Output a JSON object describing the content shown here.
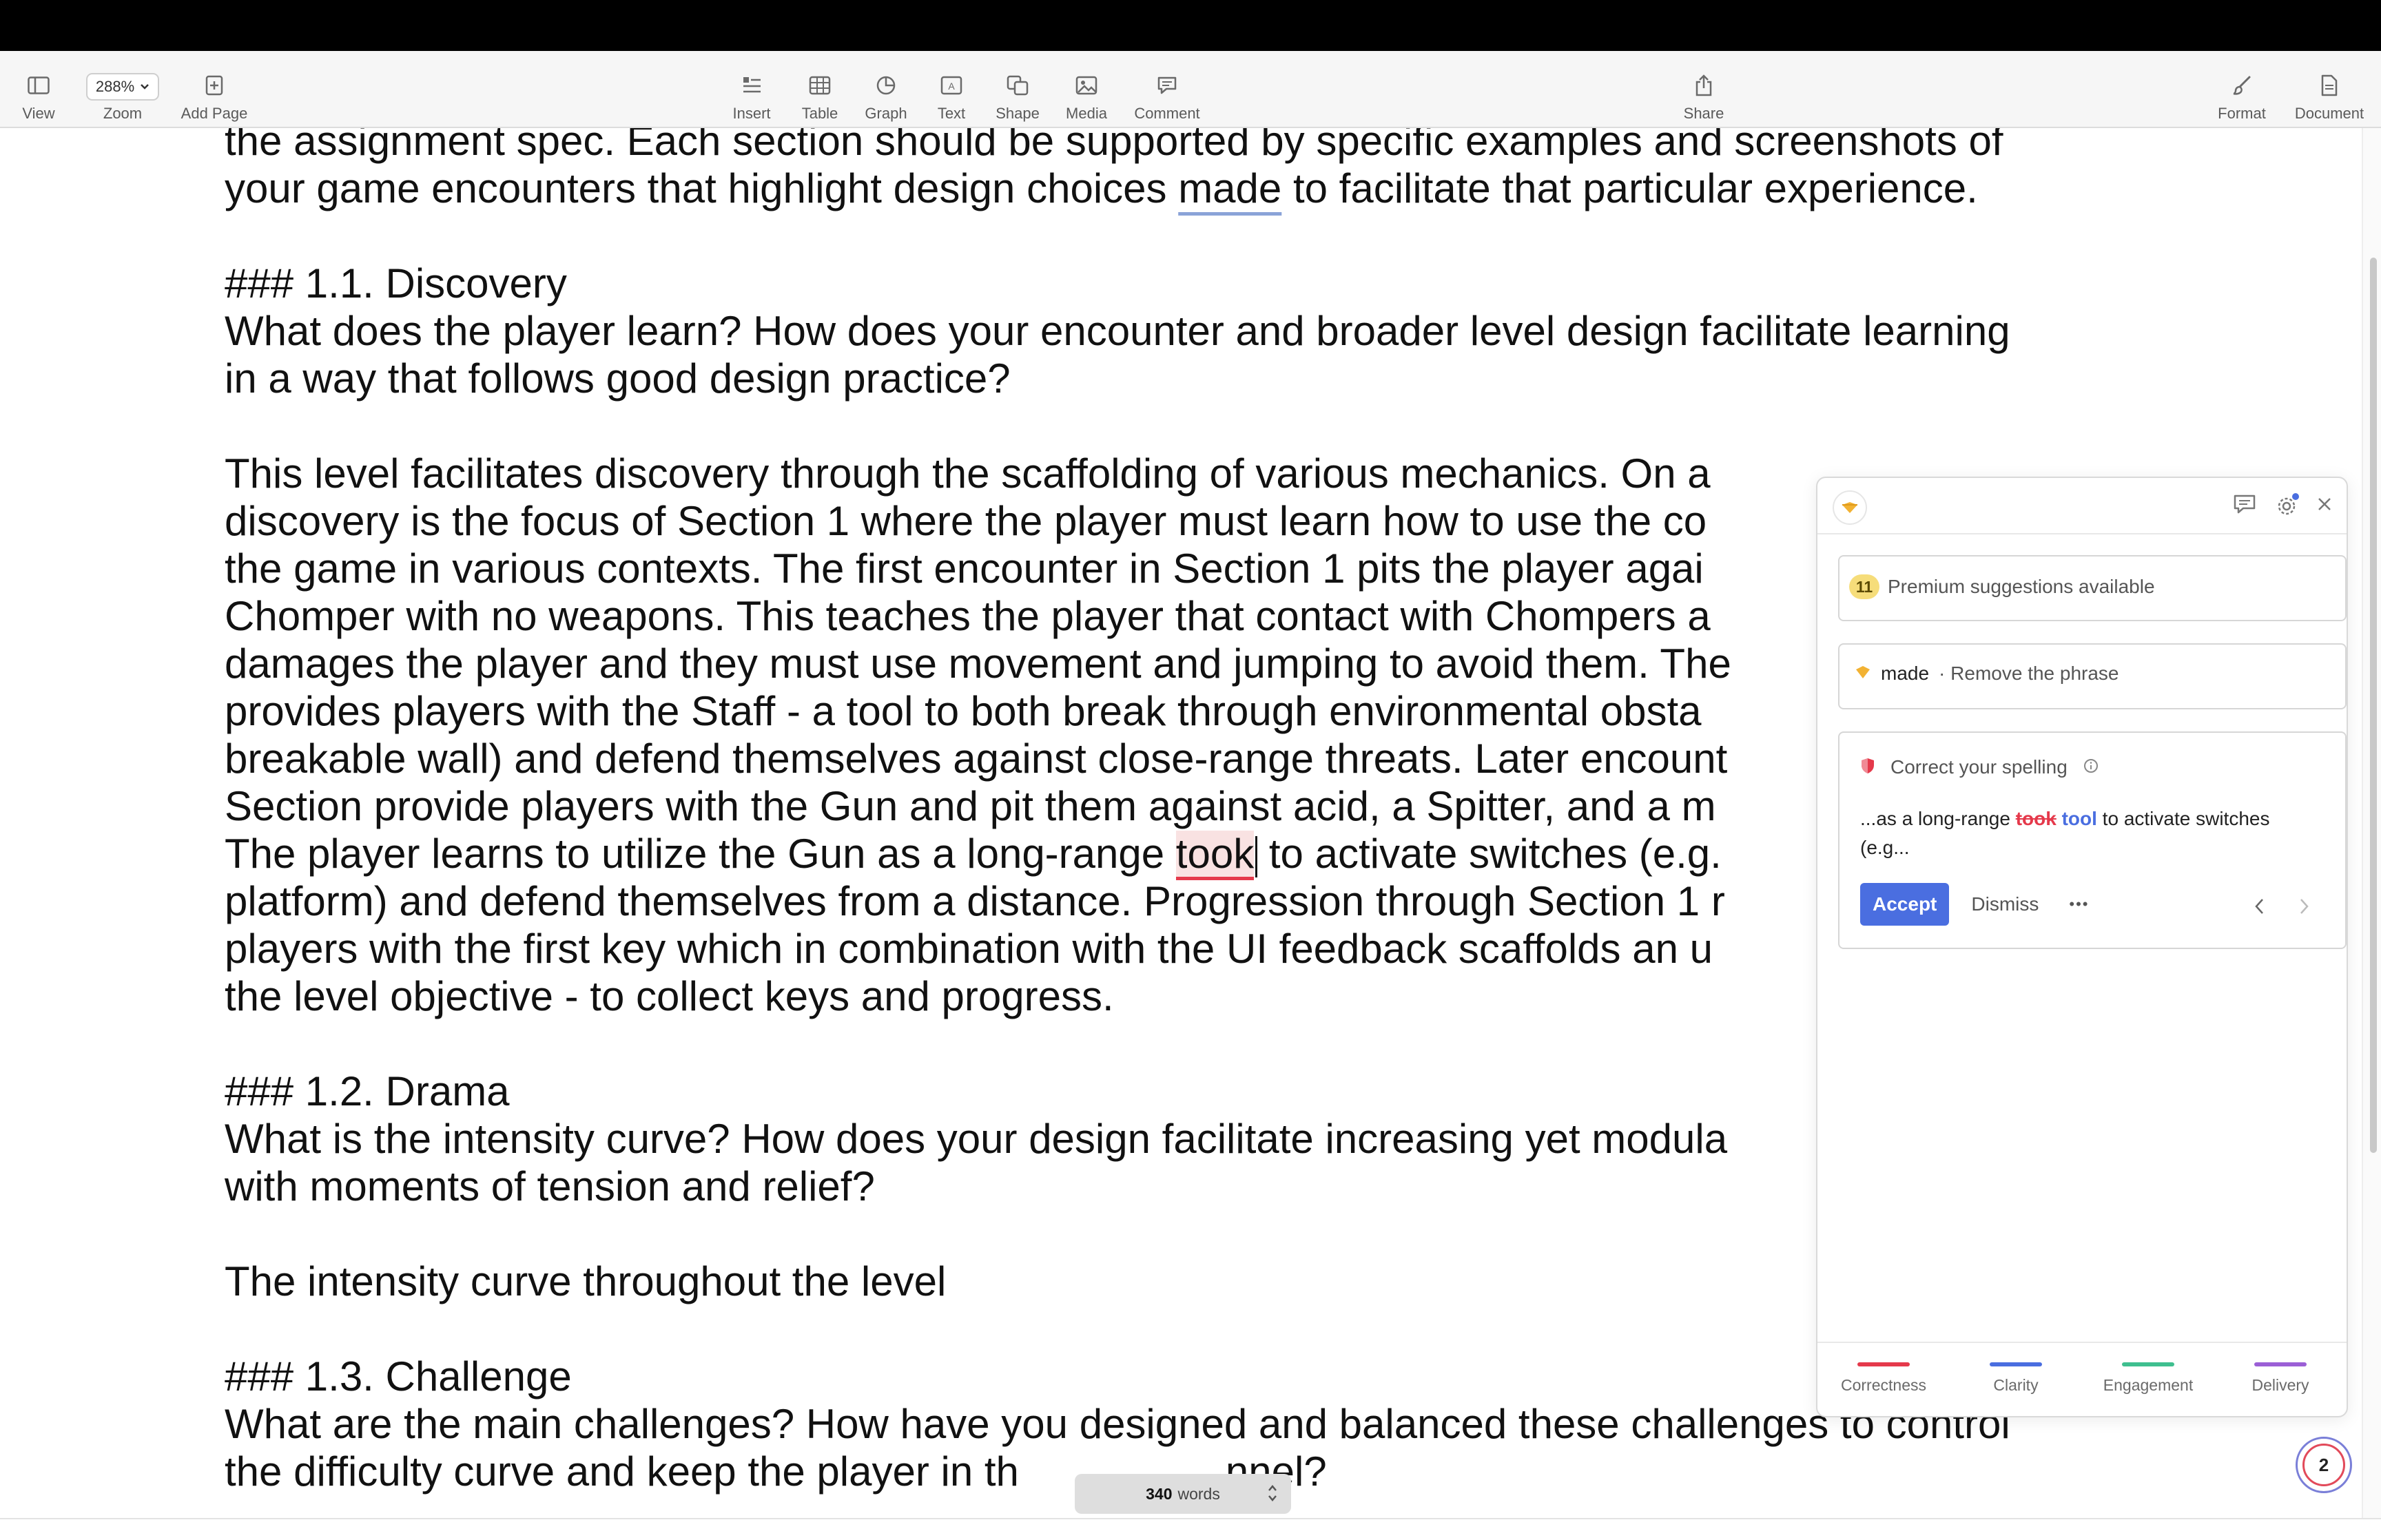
{
  "toolbar": {
    "view_label": "View",
    "zoom_value": "288%",
    "zoom_label": "Zoom",
    "add_page_label": "Add Page",
    "insert_label": "Insert",
    "table_label": "Table",
    "graph_label": "Graph",
    "text_label": "Text",
    "shape_label": "Shape",
    "media_label": "Media",
    "comment_label": "Comment",
    "share_label": "Share",
    "format_label": "Format",
    "document_label": "Document"
  },
  "document": {
    "line1": "the assignment spec. Each section should be supported by specific examples and screenshots of",
    "line2_a": "your game encounters that highlight design choices ",
    "line2_b": "made",
    "line2_c": " to facilitate that particular experience.",
    "h_discovery": "### 1.1. Discovery",
    "discovery_q1": "What does the player learn? How does your encounter and broader level design facilitate learning",
    "discovery_q2": "in a way that follows good design practice?",
    "para": [
      "This level facilitates discovery through the scaffolding of various mechanics. On a",
      "discovery is the focus of Section 1 where the player must learn how to use the co",
      "the game in various contexts. The first encounter in Section 1 pits the player agai",
      "Chomper with no weapons. This teaches the player that contact with Chompers a",
      "damages the player and they must use movement and jumping to avoid them. The",
      "provides players with the Staff - a tool to both break through environmental obsta",
      "breakable wall) and defend themselves against close-range threats. Later encount",
      "Section provide players with the Gun and pit them against acid, a Spitter, and a m"
    ],
    "para_took_a": "The player learns to utilize the Gun as a long-range ",
    "para_took_b": "took",
    "para_took_c": " to activate switches (e.g.",
    "para_tail": [
      "platform) and defend themselves from a distance. Progression through Section 1 r",
      "players with the first key which in combination with the UI feedback scaffolds an u",
      "the level objective - to collect keys and progress."
    ],
    "h_drama": "### 1.2. Drama",
    "drama_q1": "What is the intensity curve? How does your design facilitate increasing yet modula",
    "drama_q2": "with moments of tension and relief?",
    "drama_ans": "The intensity curve throughout the level",
    "h_challenge": "### 1.3. Challenge",
    "challenge_q1": "What are the main challenges? How have you designed and balanced these challenges to control",
    "challenge_q2": "the difficulty curve and keep the player in th",
    "challenge_q2_end": "nnel?"
  },
  "word_count": {
    "count": "340",
    "label": "words"
  },
  "grammarly": {
    "premium_count": "11",
    "premium_text": "Premium suggestions available",
    "made_word": "made",
    "made_suggestion": "· Remove the phrase",
    "spelling_title": "Correct your spelling",
    "context_prefix": "...as a long-range ",
    "context_wrong": "took",
    "context_fix": "tool",
    "context_suffix": " to activate switches",
    "context_line2": "(e.g...",
    "accept_label": "Accept",
    "dismiss_label": "Dismiss",
    "more_label": "•••",
    "tabs": [
      {
        "label": "Correctness",
        "color": "#e5394b"
      },
      {
        "label": "Clarity",
        "color": "#4a6ee0"
      },
      {
        "label": "Engagement",
        "color": "#3fbf8f"
      },
      {
        "label": "Delivery",
        "color": "#9b5fd6"
      }
    ],
    "badge_count": "2"
  }
}
